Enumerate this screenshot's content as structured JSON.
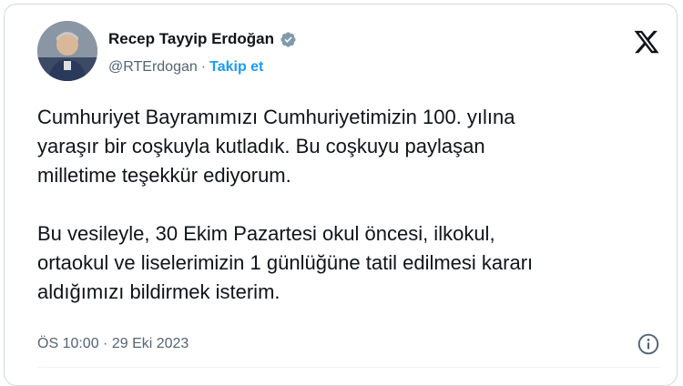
{
  "author": {
    "display_name": "Recep Tayyip Erdoğan",
    "handle": "@RTErdogan",
    "separator": "·",
    "follow_label": "Takip et",
    "verified_color": "#829aab"
  },
  "tweet": {
    "paragraph_1": "Cumhuriyet Bayramımızı Cumhuriyetimizin 100. yılına\nyaraşır bir coşkuyla kutladık. Bu coşkuyu paylaşan\nmilletime teşekkür ediyorum.",
    "paragraph_2": "Bu vesileyle, 30 Ekim Pazartesi okul öncesi, ilkokul,\nortaokul ve liselerimizin 1 günlüğüne tatil edilmesi kararı\naldığımızı bildirmek isterim."
  },
  "meta": {
    "timestamp": "ÖS 10:00 · 29 Eki 2023"
  },
  "icons": {
    "avatar": "profile-photo",
    "verified": "verified-badge-icon",
    "brand": "x-logo-icon",
    "info": "info-icon"
  },
  "colors": {
    "text": "#0f1419",
    "secondary": "#536471",
    "link": "#1d9bf0",
    "border": "#cfd9de"
  }
}
